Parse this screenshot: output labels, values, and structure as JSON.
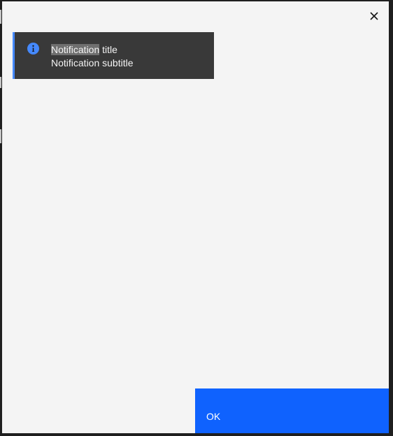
{
  "modal": {
    "close_icon": "close-icon"
  },
  "notification": {
    "kind": "info",
    "icon": "info-icon",
    "accent_color": "#4589ff",
    "title_highlight": "Notification",
    "title_rest": " title",
    "subtitle": "Notification subtitle"
  },
  "footer": {
    "primary_label": "OK",
    "primary_color": "#0f62fe"
  }
}
